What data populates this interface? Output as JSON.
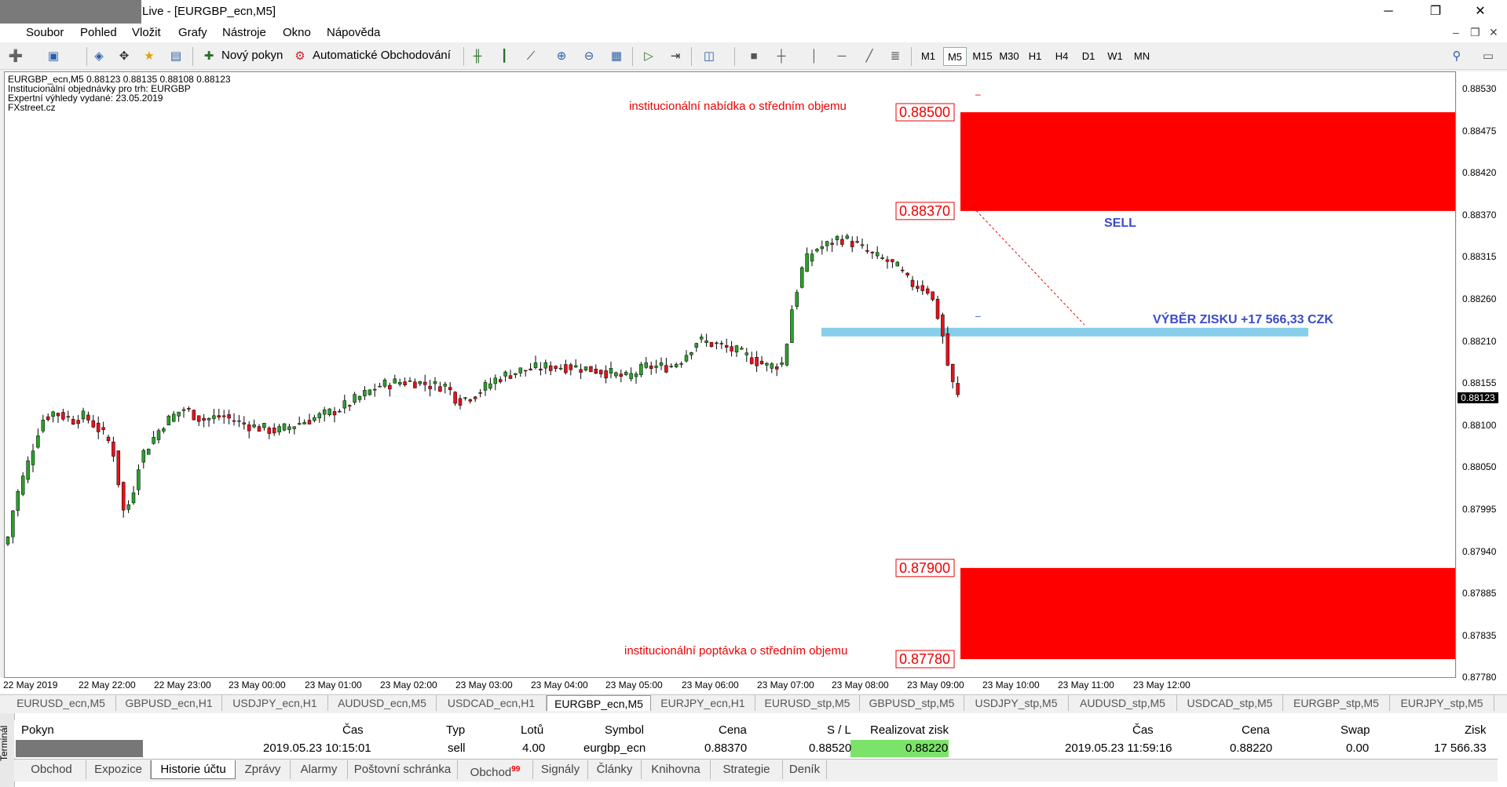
{
  "window": {
    "title": "Live - [EURGBP_ecn,M5]",
    "minimize": "─",
    "restore": "❐",
    "close": "✕"
  },
  "menu": {
    "items": [
      "Soubor",
      "Pohled",
      "Vložit",
      "Grafy",
      "Nástroje",
      "Okno",
      "Nápověda"
    ],
    "right": [
      "‒",
      "❐",
      "✕"
    ]
  },
  "toolbar": {
    "new_order": "Nový pokyn",
    "auto_trading": "Automatické Obchodování",
    "timeframes": [
      "M1",
      "M5",
      "M15",
      "M30",
      "H1",
      "H4",
      "D1",
      "W1",
      "MN"
    ],
    "active_timeframe": "M5"
  },
  "chart": {
    "header": "EURGBP_ecn,M5  0.88123 0.88135 0.88108 0.88123",
    "info_lines": [
      "Institucionální objednávky pro trh: EURGBP",
      "Expertní výhledy vydané: 23.05.2019",
      "FXstreet.cz"
    ],
    "zone_top_label": "institucionální nabídka o středním objemu",
    "zone_bottom_label": "institucionální poptávka o středním objemu",
    "level_labels": [
      "0.88500",
      "0.88370",
      "0.87900",
      "0.87780"
    ],
    "sell_label": "SELL",
    "profit_label": "VÝBĚR ZISKU +17 566,33 CZK",
    "current_price": "0.88123",
    "price_ticks": [
      "0.88530",
      "0.88475",
      "0.88420",
      "0.88370",
      "0.88315",
      "0.88260",
      "0.88210",
      "0.88155",
      "0.88100",
      "0.88050",
      "0.87995",
      "0.87940",
      "0.87885",
      "0.87835",
      "0.87780"
    ],
    "time_ticks": [
      "22 May 2019",
      "22 May 22:00",
      "22 May 23:00",
      "23 May 00:00",
      "23 May 01:00",
      "23 May 02:00",
      "23 May 03:00",
      "23 May 04:00",
      "23 May 05:00",
      "23 May 06:00",
      "23 May 07:00",
      "23 May 08:00",
      "23 May 09:00",
      "23 May 10:00",
      "23 May 11:00",
      "23 May 12:00"
    ],
    "colors": {
      "bull": "#2ca02c",
      "bear": "#e8101a",
      "zone": "#ff0000",
      "support": "#87ceeb",
      "label_blue": "#3a4cc8"
    }
  },
  "symbol_tabs": [
    "EURUSD_ecn,M5",
    "GBPUSD_ecn,H1",
    "USDJPY_ecn,H1",
    "AUDUSD_ecn,M5",
    "USDCAD_ecn,H1",
    "EURGBP_ecn,M5",
    "EURJPY_ecn,H1",
    "EURUSD_stp,M5",
    "GBPUSD_stp,M5",
    "USDJPY_stp,M5",
    "AUDUSD_stp,M5",
    "USDCAD_stp,M5",
    "EURGBP_stp,M5",
    "EURJPY_stp,M5"
  ],
  "active_symbol_tab": "EURGBP_ecn,M5",
  "terminal": {
    "side_label": "Terminál",
    "columns": [
      "Pokyn",
      "Čas",
      "Typ",
      "Lotů",
      "Symbol",
      "Cena",
      "S / L",
      "Realizovat zisk",
      "Čas",
      "Cena",
      "Swap",
      "Zisk"
    ],
    "row": {
      "time_open": "2019.05.23 10:15:01",
      "type": "sell",
      "lots": "4.00",
      "symbol": "eurgbp_ecn",
      "price_open": "0.88370",
      "sl": "0.88520",
      "tp": "0.88220",
      "time_close": "2019.05.23 11:59:16",
      "price_close": "0.88220",
      "swap": "0.00",
      "profit": "17 566.33"
    },
    "tabs": [
      "Obchod",
      "Expozice",
      "Historie účtu",
      "Zprávy",
      "Alarmy",
      "Poštovní schránka",
      "Obchod",
      "Signály",
      "Články",
      "Knihovna",
      "Strategie",
      "Deník"
    ],
    "tab_badge": "99",
    "active_tab": "Historie účtu"
  }
}
